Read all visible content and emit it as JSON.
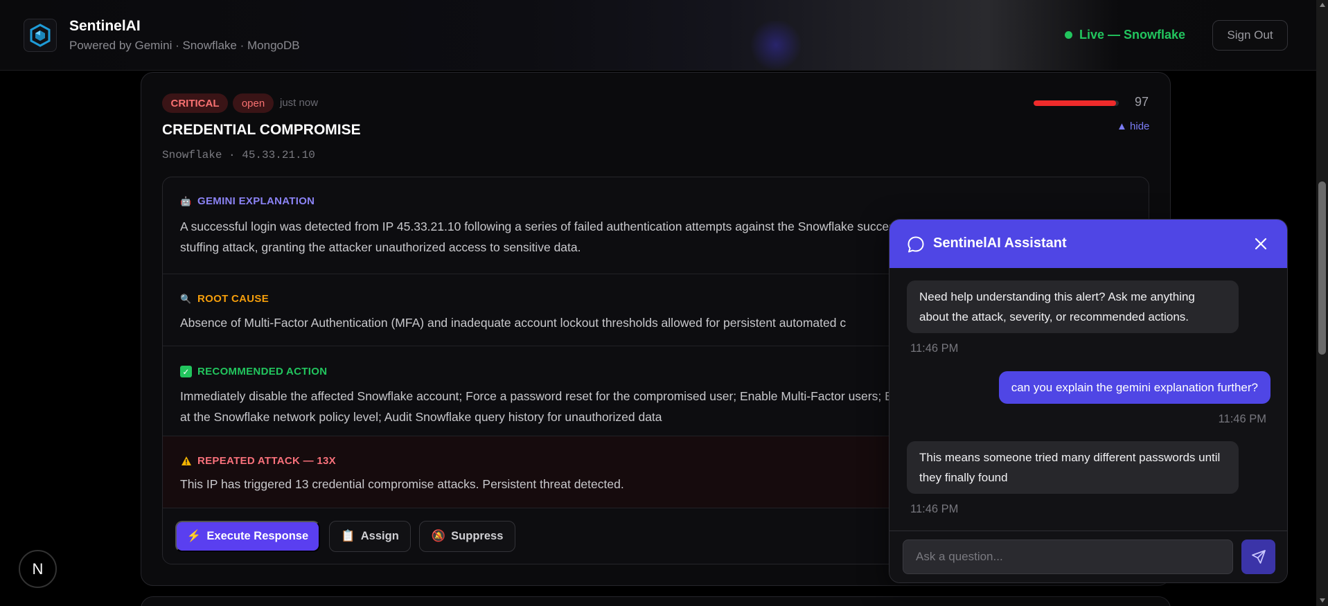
{
  "header": {
    "brand_title": "SentinelAI",
    "brand_subtitle": "Powered by Gemini · Snowflake · MongoDB",
    "live_status": "Live — Snowflake",
    "sign_out_label": "Sign Out"
  },
  "alert": {
    "severity": "CRITICAL",
    "status": "open",
    "time_ago": "just now",
    "title": "CREDENTIAL COMPROMISE",
    "source": "Snowflake · 45.33.21.10",
    "risk_score": 97,
    "risk_score_fraction": 0.97,
    "hide_label": "▲ hide",
    "sections": {
      "explanation": {
        "heading": "GEMINI EXPLANATION",
        "icon": "robot-icon",
        "body": "A successful login was detected from IP 45.33.21.10 following a series of failed authentication attempts against the Snowflake successful brute-force or credential stuffing attack, granting the attacker unauthorized access to sensitive data."
      },
      "root_cause": {
        "heading": "ROOT CAUSE",
        "icon": "magnifier-icon",
        "body": "Absence of Multi-Factor Authentication (MFA) and inadequate account lockout thresholds allowed for persistent automated c"
      },
      "recommended_action": {
        "heading": "RECOMMENDED ACTION",
        "icon": "checkmark-icon",
        "body": "Immediately disable the affected Snowflake account; Force a password reset for the compromised user; Enable Multi-Factor users; Block source IP 45.33.21.10 at the Snowflake network policy level; Audit Snowflake query history for unauthorized data"
      },
      "repeated_attack": {
        "heading": "REPEATED ATTACK — 13X",
        "icon": "warning-icon",
        "body": "This IP has triggered 13 credential compromise attacks. Persistent threat detected."
      }
    },
    "buttons": {
      "execute": "Execute Response",
      "assign": "Assign",
      "suppress": "Suppress"
    }
  },
  "chat": {
    "title": "SentinelAI Assistant",
    "messages": [
      {
        "role": "assistant",
        "text": "Need help understanding this alert? Ask me anything about the attack, severity, or recommended actions.",
        "time": "11:46 PM"
      },
      {
        "role": "user",
        "text": "can you explain the gemini explanation further?",
        "time": "11:46 PM"
      },
      {
        "role": "assistant",
        "text": "This means someone tried many different passwords until they finally found",
        "time": "11:46 PM"
      }
    ],
    "input_placeholder": "Ask a question..."
  },
  "colors": {
    "accent": "#4f46e5",
    "critical": "#f87171",
    "live": "#22c55e",
    "score_bar": "#ef2b2b"
  },
  "dev_badge": "N"
}
